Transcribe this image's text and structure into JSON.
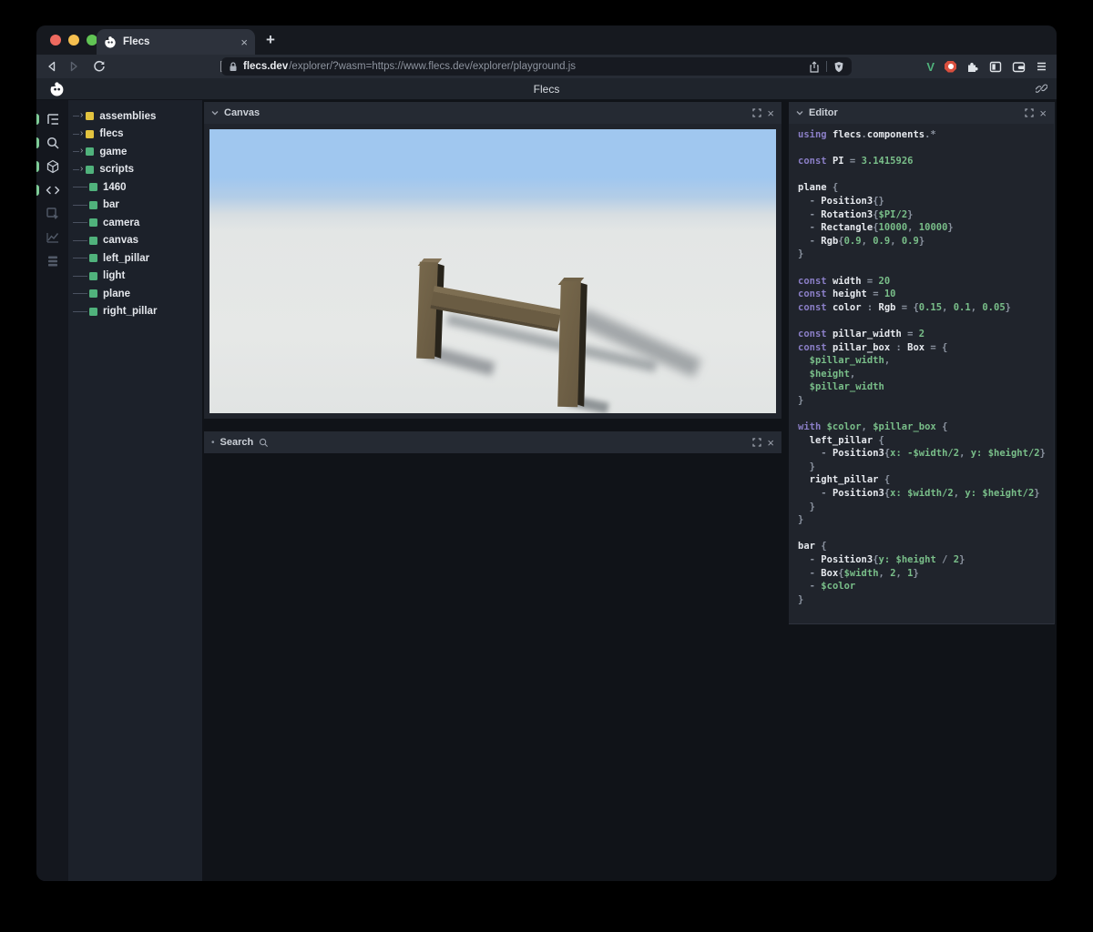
{
  "browser": {
    "tab_title": "Flecs",
    "url_domain": "flecs.dev",
    "url_path": "/explorer/?wasm=https://www.flecs.dev/explorer/playground.js",
    "vue_glyph": "V"
  },
  "glyphs": {
    "close": "×",
    "new_tab": "+",
    "collapsed_dot": "•"
  },
  "header": {
    "title": "Flecs"
  },
  "rail": {
    "items": [
      {
        "icon": "outline-tree-icon",
        "active": true
      },
      {
        "icon": "search-icon",
        "active": true
      },
      {
        "icon": "entities-cube-icon",
        "active": true
      },
      {
        "icon": "code-icon",
        "active": true
      },
      {
        "icon": "inspect-icon",
        "active": false
      },
      {
        "icon": "stats-chart-icon",
        "active": false
      },
      {
        "icon": "queries-rows-icon",
        "active": false
      }
    ]
  },
  "tree": {
    "items": [
      {
        "label": "assemblies",
        "color": "yellow",
        "expandable": true
      },
      {
        "label": "flecs",
        "color": "yellow",
        "expandable": true
      },
      {
        "label": "game",
        "color": "green",
        "expandable": true
      },
      {
        "label": "scripts",
        "color": "green",
        "expandable": true
      },
      {
        "label": "1460",
        "color": "green",
        "expandable": false
      },
      {
        "label": "bar",
        "color": "green",
        "expandable": false
      },
      {
        "label": "camera",
        "color": "green",
        "expandable": false
      },
      {
        "label": "canvas",
        "color": "green",
        "expandable": false
      },
      {
        "label": "left_pillar",
        "color": "green",
        "expandable": false
      },
      {
        "label": "light",
        "color": "green",
        "expandable": false
      },
      {
        "label": "plane",
        "color": "green",
        "expandable": false
      },
      {
        "label": "right_pillar",
        "color": "green",
        "expandable": false
      }
    ]
  },
  "panels": {
    "canvas": {
      "title": "Canvas"
    },
    "search": {
      "title": "Search"
    },
    "editor": {
      "title": "Editor"
    }
  },
  "editor_code": [
    [
      [
        "k",
        "using "
      ],
      [
        "i",
        "flecs"
      ],
      [
        "o",
        "."
      ],
      [
        "i",
        "components"
      ],
      [
        "o",
        "."
      ],
      [
        "o",
        "*"
      ]
    ],
    [],
    [
      [
        "k",
        "const "
      ],
      [
        "i",
        "PI"
      ],
      [
        "o",
        " = "
      ],
      [
        "g",
        "3.1415926"
      ]
    ],
    [],
    [
      [
        "i",
        "plane"
      ],
      [
        "o",
        " {"
      ]
    ],
    [
      [
        "o",
        "  - "
      ],
      [
        "i",
        "Position3"
      ],
      [
        "o",
        "{}"
      ]
    ],
    [
      [
        "o",
        "  - "
      ],
      [
        "i",
        "Rotation3"
      ],
      [
        "o",
        "{"
      ],
      [
        "g",
        "$PI/2"
      ],
      [
        "o",
        "}"
      ]
    ],
    [
      [
        "o",
        "  - "
      ],
      [
        "i",
        "Rectangle"
      ],
      [
        "o",
        "{"
      ],
      [
        "g",
        "10000"
      ],
      [
        "o",
        ", "
      ],
      [
        "g",
        "10000"
      ],
      [
        "o",
        "}"
      ]
    ],
    [
      [
        "o",
        "  - "
      ],
      [
        "i",
        "Rgb"
      ],
      [
        "o",
        "{"
      ],
      [
        "g",
        "0.9"
      ],
      [
        "o",
        ", "
      ],
      [
        "g",
        "0.9"
      ],
      [
        "o",
        ", "
      ],
      [
        "g",
        "0.9"
      ],
      [
        "o",
        "}"
      ]
    ],
    [
      [
        "o",
        "}"
      ]
    ],
    [],
    [
      [
        "k",
        "const "
      ],
      [
        "i",
        "width"
      ],
      [
        "o",
        " = "
      ],
      [
        "g",
        "20"
      ]
    ],
    [
      [
        "k",
        "const "
      ],
      [
        "i",
        "height"
      ],
      [
        "o",
        " = "
      ],
      [
        "g",
        "10"
      ]
    ],
    [
      [
        "k",
        "const "
      ],
      [
        "i",
        "color"
      ],
      [
        "o",
        " : "
      ],
      [
        "i",
        "Rgb"
      ],
      [
        "o",
        " = {"
      ],
      [
        "g",
        "0.15"
      ],
      [
        "o",
        ", "
      ],
      [
        "g",
        "0.1"
      ],
      [
        "o",
        ", "
      ],
      [
        "g",
        "0.05"
      ],
      [
        "o",
        "}"
      ]
    ],
    [],
    [
      [
        "k",
        "const "
      ],
      [
        "i",
        "pillar_width"
      ],
      [
        "o",
        " = "
      ],
      [
        "g",
        "2"
      ]
    ],
    [
      [
        "k",
        "const "
      ],
      [
        "i",
        "pillar_box"
      ],
      [
        "o",
        " : "
      ],
      [
        "i",
        "Box"
      ],
      [
        "o",
        " = {"
      ]
    ],
    [
      [
        "g",
        "  $pillar_width"
      ],
      [
        "o",
        ","
      ]
    ],
    [
      [
        "g",
        "  $height"
      ],
      [
        "o",
        ","
      ]
    ],
    [
      [
        "g",
        "  $pillar_width"
      ]
    ],
    [
      [
        "o",
        "}"
      ]
    ],
    [],
    [
      [
        "k",
        "with "
      ],
      [
        "g",
        "$color"
      ],
      [
        "o",
        ", "
      ],
      [
        "g",
        "$pillar_box"
      ],
      [
        "o",
        " {"
      ]
    ],
    [
      [
        "i",
        "  left_pillar"
      ],
      [
        "o",
        " {"
      ]
    ],
    [
      [
        "o",
        "    - "
      ],
      [
        "i",
        "Position3"
      ],
      [
        "o",
        "{"
      ],
      [
        "g",
        "x:"
      ],
      [
        "o",
        " "
      ],
      [
        "g",
        "-$width/2"
      ],
      [
        "o",
        ", "
      ],
      [
        "g",
        "y:"
      ],
      [
        "o",
        " "
      ],
      [
        "g",
        "$height/2"
      ],
      [
        "o",
        "}"
      ]
    ],
    [
      [
        "o",
        "  }"
      ]
    ],
    [
      [
        "i",
        "  right_pillar"
      ],
      [
        "o",
        " {"
      ]
    ],
    [
      [
        "o",
        "    - "
      ],
      [
        "i",
        "Position3"
      ],
      [
        "o",
        "{"
      ],
      [
        "g",
        "x:"
      ],
      [
        "o",
        " "
      ],
      [
        "g",
        "$width/2"
      ],
      [
        "o",
        ", "
      ],
      [
        "g",
        "y:"
      ],
      [
        "o",
        " "
      ],
      [
        "g",
        "$height/2"
      ],
      [
        "o",
        "}"
      ]
    ],
    [
      [
        "o",
        "  }"
      ]
    ],
    [
      [
        "o",
        "}"
      ]
    ],
    [],
    [
      [
        "i",
        "bar"
      ],
      [
        "o",
        " {"
      ]
    ],
    [
      [
        "o",
        "  - "
      ],
      [
        "i",
        "Position3"
      ],
      [
        "o",
        "{"
      ],
      [
        "g",
        "y:"
      ],
      [
        "o",
        " "
      ],
      [
        "g",
        "$height"
      ],
      [
        "o",
        " / "
      ],
      [
        "g",
        "2"
      ],
      [
        "o",
        "}"
      ]
    ],
    [
      [
        "o",
        "  - "
      ],
      [
        "i",
        "Box"
      ],
      [
        "o",
        "{"
      ],
      [
        "g",
        "$width"
      ],
      [
        "o",
        ", "
      ],
      [
        "g",
        "2"
      ],
      [
        "o",
        ", "
      ],
      [
        "g",
        "1"
      ],
      [
        "o",
        "}"
      ]
    ],
    [
      [
        "o",
        "  - "
      ],
      [
        "g",
        "$color"
      ]
    ],
    [
      [
        "o",
        "}"
      ]
    ]
  ],
  "colors": {
    "tl_red": "#ee6a5f",
    "tl_yellow": "#f5bf4f",
    "tl_green": "#61c454",
    "accent_green": "#50b27c",
    "accent_yellow": "#e2c33f",
    "kw": "#8a7ec6",
    "code_green": "#79be89",
    "sky": "#a0c7ef",
    "ground": "#e3e6e5",
    "wood": "#6e6047",
    "wood_dark": "#27231b",
    "wood_light": "#7d6e52"
  }
}
